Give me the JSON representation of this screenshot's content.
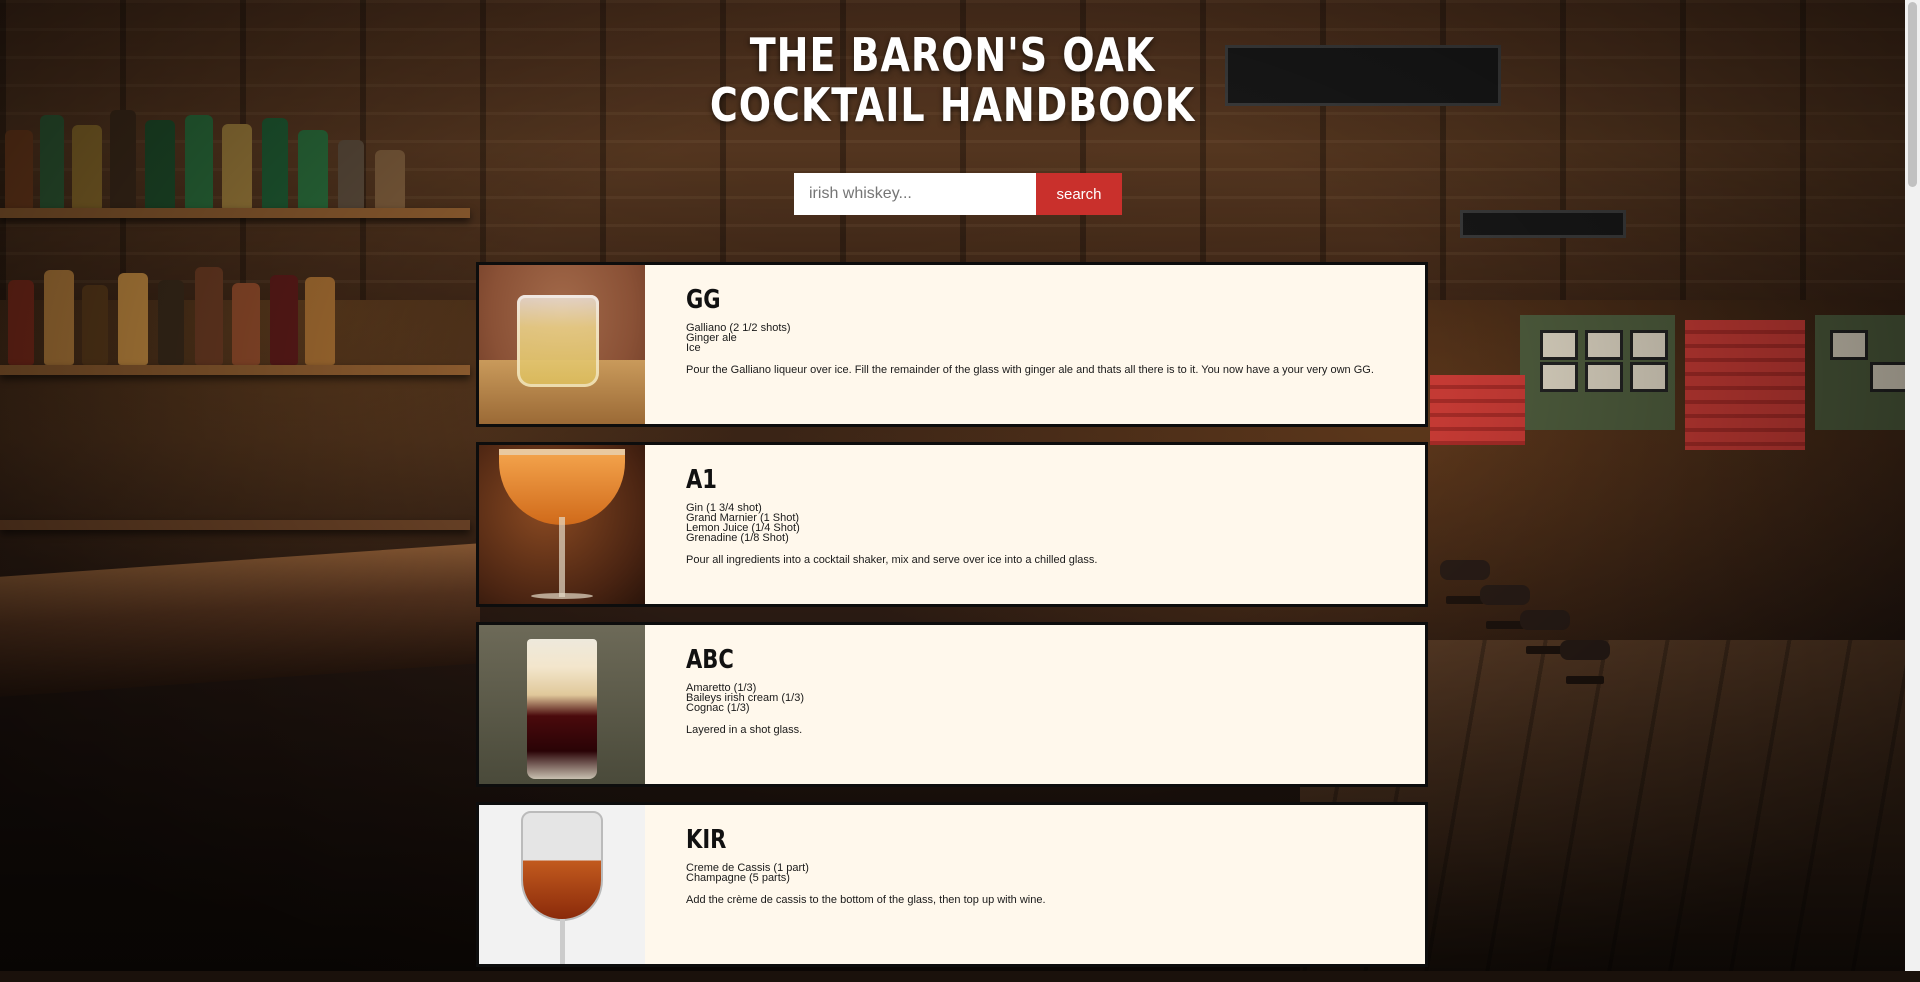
{
  "header": {
    "title_line1": "THE BARON'S OAK",
    "title_line2": "COCKTAIL HANDBOOK"
  },
  "search": {
    "placeholder": "irish whiskey...",
    "value": "",
    "button_label": "search"
  },
  "cocktails": [
    {
      "name": "GG",
      "image_icon": "whiskey-tumbler-icon",
      "ingredients": [
        "Galliano (2 1/2 shots)",
        "Ginger ale",
        "Ice"
      ],
      "method": "Pour the Galliano liqueur over ice. Fill the remainder of the glass with ginger ale and thats all there is to it. You now have a your very own GG."
    },
    {
      "name": "A1",
      "image_icon": "martini-glass-icon",
      "ingredients": [
        "Gin (1 3/4 shot)",
        "Grand Marnier (1 Shot)",
        "Lemon Juice (1/4 Shot)",
        "Grenadine (1/8 Shot)"
      ],
      "method": "Pour all ingredients into a cocktail shaker, mix and serve over ice into a chilled glass."
    },
    {
      "name": "ABC",
      "image_icon": "layered-shot-icon",
      "ingredients": [
        "Amaretto (1/3)",
        "Baileys irish cream (1/3)",
        "Cognac (1/3)"
      ],
      "method": "Layered in a shot glass."
    },
    {
      "name": "KIR",
      "image_icon": "wine-glass-icon",
      "ingredients": [
        "Creme de Cassis (1 part)",
        "Champagne (5 parts)"
      ],
      "method": "Add the crème de cassis to the bottom of the glass, then top up with wine."
    }
  ],
  "colors": {
    "card_background": "#fff8ec",
    "search_button": "#c9302c",
    "title_text": "#ffffff"
  }
}
